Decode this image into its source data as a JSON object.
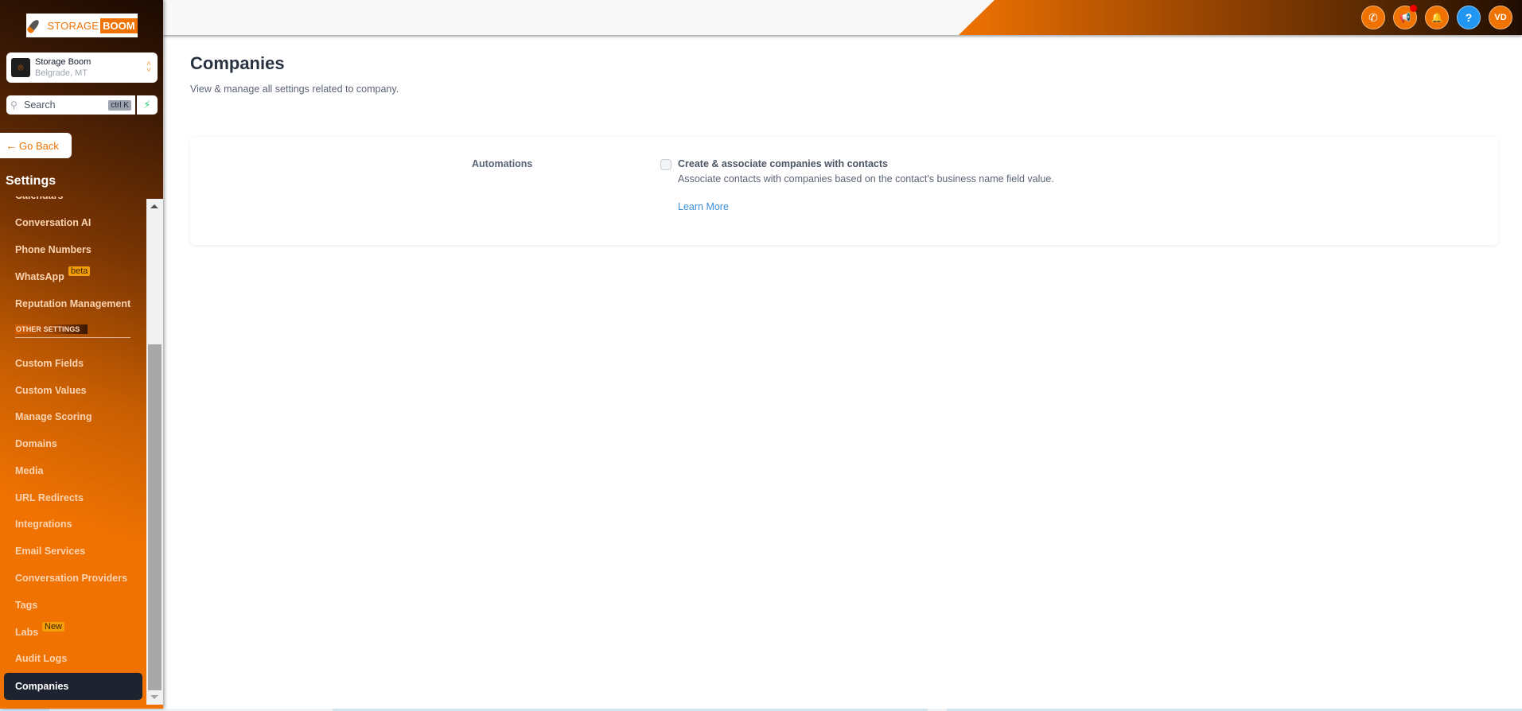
{
  "brand": {
    "logo_text_1": "STORAGE",
    "logo_text_2": "BOOM",
    "primary_color": "#f07302",
    "dark_color": "#1e2330"
  },
  "location": {
    "name": "Storage Boom",
    "address": "Belgrade, MT",
    "switch_icon": "chevron-up-down-icon"
  },
  "search": {
    "placeholder": "Search",
    "shortcut": "ctrl K",
    "quick_action_icon": "lightning-icon"
  },
  "sidebar": {
    "go_back_label": "Go Back",
    "section_title": "Settings",
    "partial_item": "Calendars",
    "items_top": [
      {
        "label": "Conversation AI"
      },
      {
        "label": "Phone Numbers"
      },
      {
        "label": "WhatsApp",
        "badge": "beta"
      },
      {
        "label": "Reputation Management"
      }
    ],
    "other_settings_label": "OTHER SETTINGS",
    "items_other": [
      {
        "label": "Custom Fields"
      },
      {
        "label": "Custom Values"
      },
      {
        "label": "Manage Scoring"
      },
      {
        "label": "Domains"
      },
      {
        "label": "Media"
      },
      {
        "label": "URL Redirects"
      },
      {
        "label": "Integrations"
      },
      {
        "label": "Email Services"
      },
      {
        "label": "Conversation Providers"
      },
      {
        "label": "Tags"
      },
      {
        "label": "Labs",
        "badge": "New"
      },
      {
        "label": "Audit Logs"
      },
      {
        "label": "Companies",
        "active": true
      }
    ]
  },
  "header": {
    "icons": [
      {
        "name": "phone-icon",
        "glyph": "✆"
      },
      {
        "name": "announcement-icon",
        "glyph": "📢",
        "has_notification": true
      },
      {
        "name": "bell-icon",
        "glyph": "🔔"
      },
      {
        "name": "help-icon",
        "glyph": "?"
      },
      {
        "name": "user-avatar",
        "glyph": "VD"
      }
    ]
  },
  "page": {
    "title": "Companies",
    "subtitle": "View & manage all settings related to company."
  },
  "automations": {
    "label": "Automations",
    "option_title": "Create & associate companies with contacts",
    "option_description": "Associate contacts with companies based on the contact's business name field value.",
    "checked": false,
    "learn_more_label": "Learn More"
  }
}
